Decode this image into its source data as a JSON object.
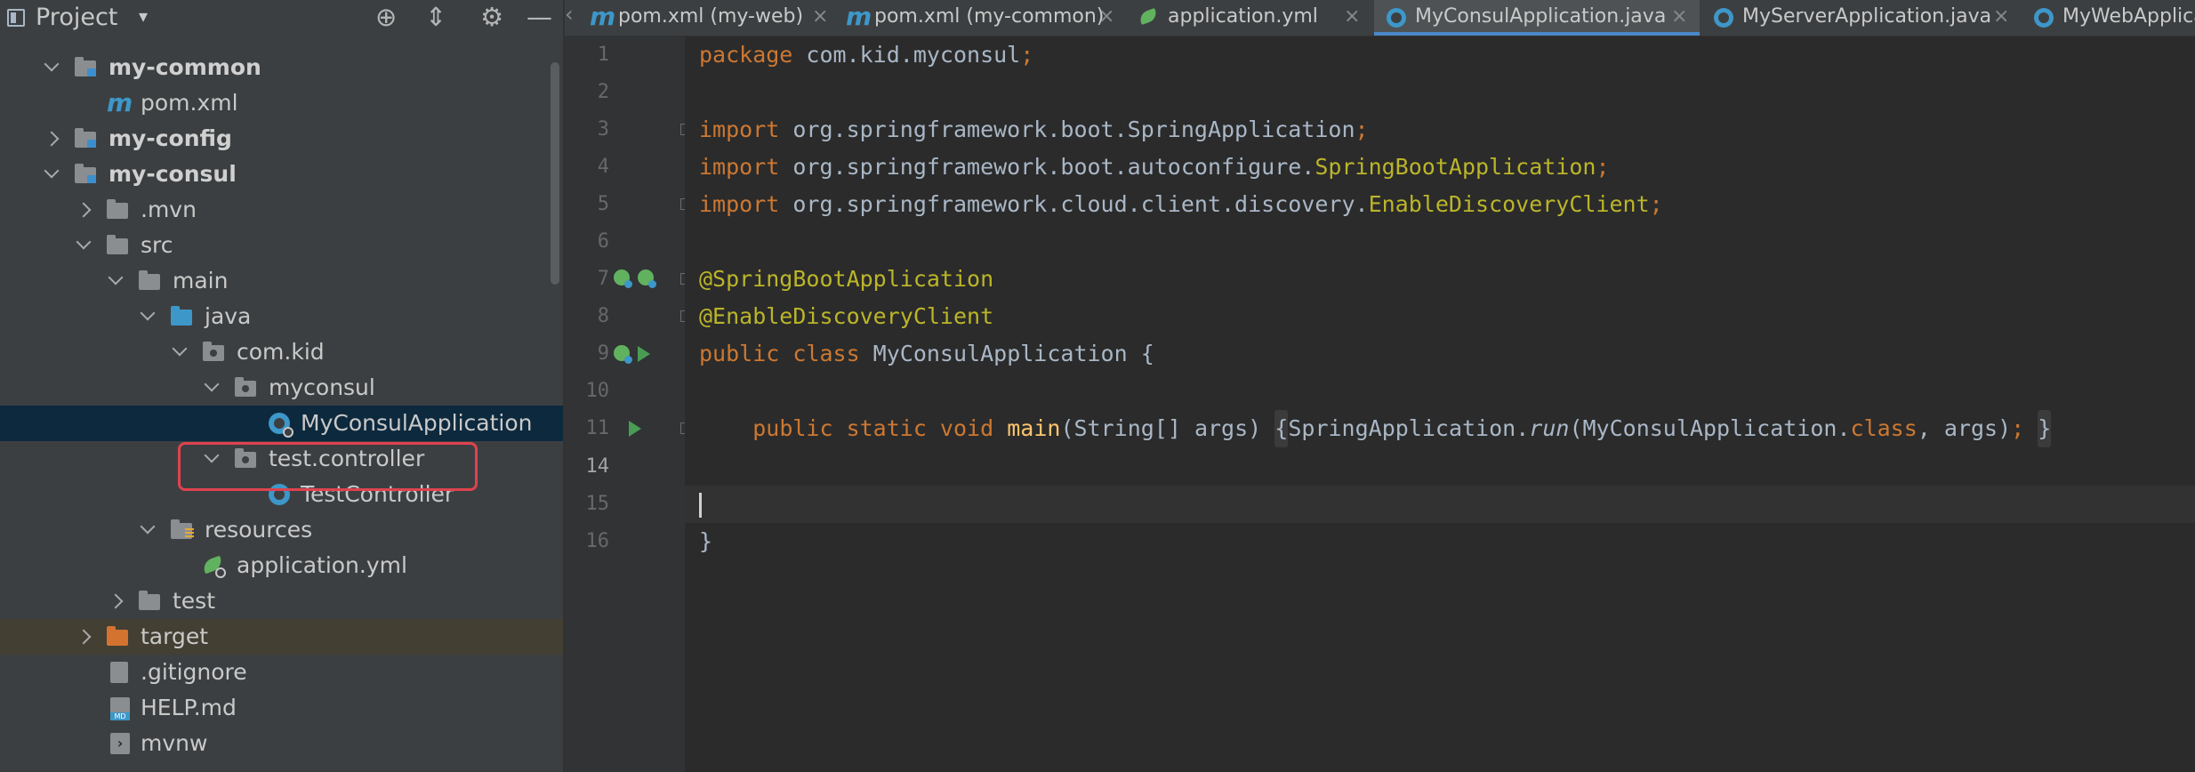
{
  "project_panel": {
    "title": "Project",
    "dropdown_glyph": "▾",
    "header_icons": {
      "locate": "⊕",
      "collapse": "⇕",
      "settings": "⚙",
      "hide": "—"
    },
    "tree": [
      {
        "label": "my-common",
        "icon": "module-folder-icon",
        "expanded": true
      },
      {
        "label": "pom.xml",
        "icon": "maven-icon"
      },
      {
        "label": "my-config",
        "icon": "module-folder-icon",
        "expanded": false
      },
      {
        "label": "my-consul",
        "icon": "module-folder-icon",
        "expanded": true
      },
      {
        "label": ".mvn",
        "icon": "folder-icon",
        "expanded": false
      },
      {
        "label": "src",
        "icon": "folder-icon",
        "expanded": true
      },
      {
        "label": "main",
        "icon": "folder-icon",
        "expanded": true
      },
      {
        "label": "java",
        "icon": "source-folder-icon",
        "expanded": true
      },
      {
        "label": "com.kid",
        "icon": "package-icon",
        "expanded": true
      },
      {
        "label": "myconsul",
        "icon": "package-icon",
        "expanded": true
      },
      {
        "label": "MyConsulApplication",
        "icon": "spring-boot-class-icon",
        "selected": true
      },
      {
        "label": "test.controller",
        "icon": "package-icon",
        "expanded": true,
        "highlighted": true
      },
      {
        "label": "TestController",
        "icon": "class-icon"
      },
      {
        "label": "resources",
        "icon": "resources-folder-icon",
        "expanded": true
      },
      {
        "label": "application.yml",
        "icon": "spring-config-icon"
      },
      {
        "label": "test",
        "icon": "folder-icon",
        "expanded": false
      },
      {
        "label": "target",
        "icon": "excluded-folder-icon",
        "expanded": false
      },
      {
        "label": ".gitignore",
        "icon": "file-icon"
      },
      {
        "label": "HELP.md",
        "icon": "markdown-icon"
      },
      {
        "label": "mvnw",
        "icon": "script-icon"
      }
    ]
  },
  "tabs": [
    {
      "label": "pom.xml (my-web)",
      "icon": "maven-icon"
    },
    {
      "label": "pom.xml (my-common)",
      "icon": "maven-icon"
    },
    {
      "label": "application.yml",
      "icon": "spring-config-icon"
    },
    {
      "label": "MyConsulApplication.java",
      "icon": "spring-boot-class-icon",
      "active": true
    },
    {
      "label": "MyServerApplication.java",
      "icon": "spring-boot-class-icon"
    },
    {
      "label": "MyWebApplica",
      "icon": "spring-boot-class-icon"
    }
  ],
  "tab_close_glyph": "×",
  "editor": {
    "line_numbers": [
      "1",
      "2",
      "3",
      "4",
      "5",
      "6",
      "7",
      "8",
      "9",
      "10",
      "11",
      "14",
      "15",
      "16"
    ],
    "current_line": "14",
    "code": {
      "l1": {
        "kw": "package",
        "rest": " com.kid.myconsul",
        "semi": ";"
      },
      "l3": {
        "kw": "import",
        "rest": " org.springframework.boot.SpringApplication",
        "semi": ";"
      },
      "l4": {
        "kw": "import",
        "rest": " org.springframework.boot.autoconfigure.",
        "cls": "SpringBootApplication",
        "semi": ";"
      },
      "l5": {
        "kw": "import",
        "rest": " org.springframework.cloud.client.discovery.",
        "cls": "EnableDiscoveryClient",
        "semi": ";"
      },
      "l7": {
        "ann": "@SpringBootApplication"
      },
      "l8": {
        "ann": "@EnableDiscoveryClient"
      },
      "l9": {
        "kw": "public class",
        "rest": " MyConsulApplication {"
      },
      "l11": {
        "indent": "    ",
        "kw": "public static void",
        "fn": "main",
        "params": "(String[] args)",
        "open": "{",
        "call_cls": "SpringApplication.",
        "call_fn": "run",
        "args_a": "(MyConsulApplication.",
        "args_kw": "class",
        "args_b": ", args)",
        "semi": ";",
        "close": "}"
      },
      "l15": {
        "rest": "}"
      }
    }
  }
}
